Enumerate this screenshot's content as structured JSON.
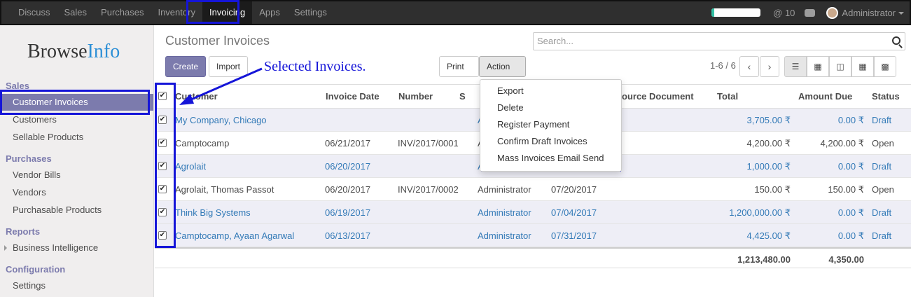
{
  "topbar": {
    "menu": [
      "Discuss",
      "Sales",
      "Purchases",
      "Inventory",
      "Invoicing",
      "Apps",
      "Settings"
    ],
    "active": "Invoicing",
    "progress": 0.05,
    "mentions": "@ 10",
    "user": "Administrator"
  },
  "sidebar": {
    "logo_a": "Browse",
    "logo_b": "Info",
    "sections": [
      {
        "title": "Sales",
        "items": [
          "Customer Invoices",
          "Customers",
          "Sellable Products"
        ]
      },
      {
        "title": "Purchases",
        "items": [
          "Vendor Bills",
          "Vendors",
          "Purchasable Products"
        ]
      },
      {
        "title": "Reports",
        "items": [
          "Business Intelligence"
        ]
      },
      {
        "title": "Configuration",
        "items": [
          "Settings"
        ]
      }
    ]
  },
  "main": {
    "title": "Customer Invoices",
    "search_placeholder": "Search...",
    "create": "Create",
    "import": "Import",
    "print": "Print",
    "action": "Action",
    "pager": "1-6 / 6",
    "callout": "Selected Invoices."
  },
  "action_menu": [
    "Export",
    "Delete",
    "Register Payment",
    "Confirm Draft Invoices",
    "Mass Invoices Email Send"
  ],
  "table": {
    "headers": [
      "Customer",
      "Invoice Date",
      "Number",
      "S",
      "ource Document",
      "Total",
      "Amount Due",
      "Status"
    ],
    "rows": [
      {
        "customer": "My Company, Chicago",
        "date": "",
        "number": "",
        "sp": "A",
        "due": "",
        "total": "3,705.00 ₹",
        "amount_due": "0.00 ₹",
        "status": "Draft",
        "draft": true
      },
      {
        "customer": "Camptocamp",
        "date": "06/21/2017",
        "number": "INV/2017/0001",
        "sp": "A",
        "due": "",
        "total": "4,200.00 ₹",
        "amount_due": "4,200.00 ₹",
        "status": "Open",
        "draft": false
      },
      {
        "customer": "Agrolait",
        "date": "06/20/2017",
        "number": "",
        "sp": "A",
        "due": "",
        "total": "1,000.00 ₹",
        "amount_due": "0.00 ₹",
        "status": "Draft",
        "draft": true
      },
      {
        "customer": "Agrolait, Thomas Passot",
        "date": "06/20/2017",
        "number": "INV/2017/0002",
        "sp": "Administrator",
        "due": "07/20/2017",
        "total": "150.00 ₹",
        "amount_due": "150.00 ₹",
        "status": "Open",
        "draft": false
      },
      {
        "customer": "Think Big Systems",
        "date": "06/19/2017",
        "number": "",
        "sp": "Administrator",
        "due": "07/04/2017",
        "total": "1,200,000.00 ₹",
        "amount_due": "0.00 ₹",
        "status": "Draft",
        "draft": true
      },
      {
        "customer": "Camptocamp, Ayaan Agarwal",
        "date": "06/13/2017",
        "number": "",
        "sp": "Administrator",
        "due": "07/31/2017",
        "total": "4,425.00 ₹",
        "amount_due": "0.00 ₹",
        "status": "Draft",
        "draft": true
      }
    ],
    "sum_total": "1,213,480.00",
    "sum_due": "4,350.00"
  },
  "colors": {
    "accent": "#7c7bad",
    "highlight": "#1515d8",
    "link": "#337ab7"
  }
}
